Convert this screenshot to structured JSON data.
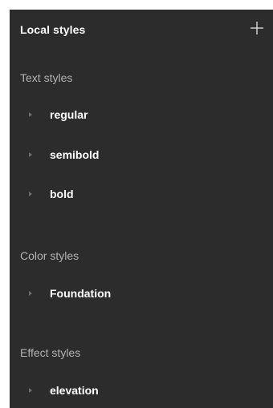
{
  "panel": {
    "title": "Local styles",
    "add_icon": "plus-icon"
  },
  "sections": {
    "text": {
      "title": "Text styles",
      "items": [
        "regular",
        "semibold",
        "bold"
      ]
    },
    "color": {
      "title": "Color styles",
      "items": [
        "Foundation"
      ]
    },
    "effect": {
      "title": "Effect styles",
      "items": [
        "elevation"
      ]
    }
  },
  "colors": {
    "panel_bg": "#2c2c2c",
    "text_primary": "#ffffff",
    "text_secondary": "#b3b3b3",
    "caret": "#6e6e6e"
  }
}
